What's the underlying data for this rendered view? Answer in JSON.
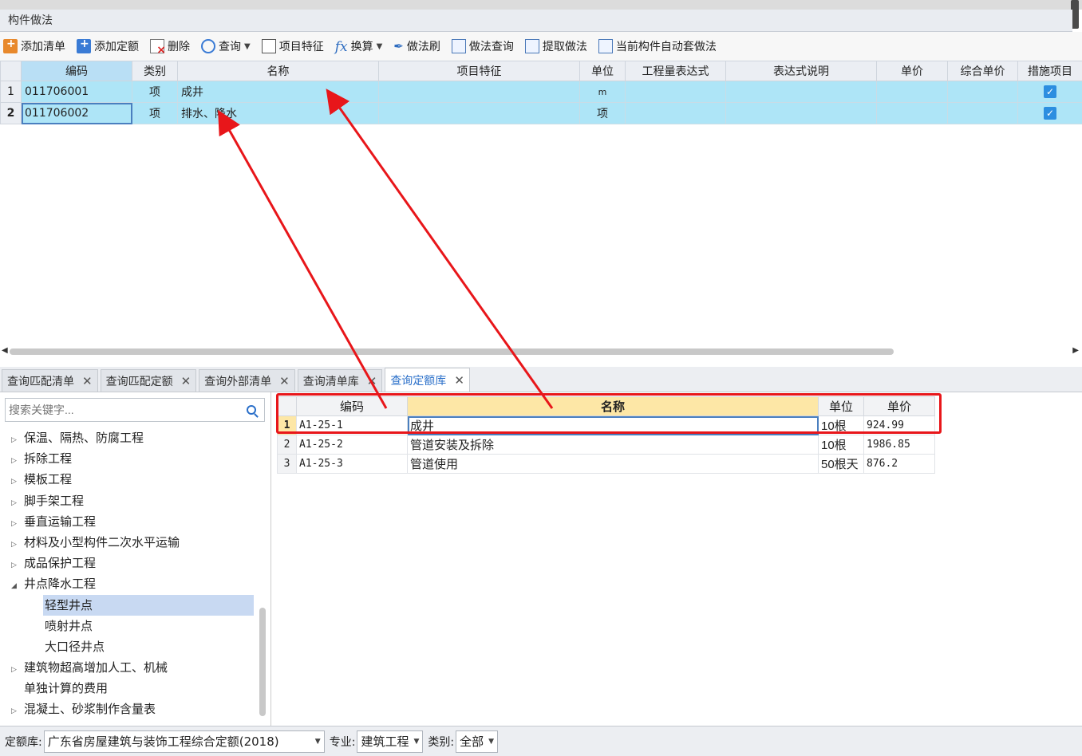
{
  "panel_title": "构件做法",
  "toolbar": {
    "add_list": "添加清单",
    "add_quota": "添加定额",
    "delete": "删除",
    "query": "查询",
    "feature": "项目特征",
    "fx_icon": "fx",
    "convert": "换算",
    "method_brush": "做法刷",
    "method_query": "做法查询",
    "extract": "提取做法",
    "auto_apply": "当前构件自动套做法"
  },
  "grid1": {
    "columns": [
      "编码",
      "类别",
      "名称",
      "项目特征",
      "单位",
      "工程量表达式",
      "表达式说明",
      "单价",
      "综合单价",
      "措施项目"
    ],
    "rows": [
      {
        "num": "1",
        "code": "011706001",
        "type": "项",
        "name": "成井",
        "feature": "",
        "unit": "m",
        "checked": true
      },
      {
        "num": "2",
        "code": "011706002",
        "type": "项",
        "name": "排水、降水",
        "feature": "",
        "unit": "项",
        "checked": true
      }
    ]
  },
  "tabs": [
    {
      "label": "查询匹配清单",
      "active": false
    },
    {
      "label": "查询匹配定额",
      "active": false
    },
    {
      "label": "查询外部清单",
      "active": false
    },
    {
      "label": "查询清单库",
      "active": false
    },
    {
      "label": "查询定额库",
      "active": true
    }
  ],
  "search": {
    "placeholder": "搜索关键字..."
  },
  "tree": [
    {
      "label": "保温、隔热、防腐工程",
      "type": "collapsed"
    },
    {
      "label": "拆除工程",
      "type": "collapsed"
    },
    {
      "label": "模板工程",
      "type": "collapsed"
    },
    {
      "label": "脚手架工程",
      "type": "collapsed"
    },
    {
      "label": "垂直运输工程",
      "type": "collapsed"
    },
    {
      "label": "材料及小型构件二次水平运输",
      "type": "collapsed"
    },
    {
      "label": "成品保护工程",
      "type": "collapsed"
    },
    {
      "label": "井点降水工程",
      "type": "expanded"
    },
    {
      "label": "轻型井点",
      "type": "child",
      "selected": true
    },
    {
      "label": "喷射井点",
      "type": "child"
    },
    {
      "label": "大口径井点",
      "type": "child"
    },
    {
      "label": "建筑物超高增加人工、机械",
      "type": "collapsed"
    },
    {
      "label": "单独计算的费用",
      "type": "leaf"
    },
    {
      "label": "混凝土、砂浆制作含量表",
      "type": "collapsed"
    }
  ],
  "grid2": {
    "columns": [
      "编码",
      "名称",
      "单位",
      "单价"
    ],
    "rows": [
      {
        "num": "1",
        "code": "A1-25-1",
        "name": "成井",
        "unit": "10根",
        "price": "924.99"
      },
      {
        "num": "2",
        "code": "A1-25-2",
        "name": "管道安装及拆除",
        "unit": "10根",
        "price": "1986.85"
      },
      {
        "num": "3",
        "code": "A1-25-3",
        "name": "管道使用",
        "unit": "50根天",
        "price": "876.2"
      }
    ]
  },
  "statusbar": {
    "quota_lib_label": "定额库:",
    "quota_lib_value": "广东省房屋建筑与装饰工程综合定额(2018)",
    "major_label": "专业:",
    "major_value": "建筑工程",
    "category_label": "类别:",
    "category_value": "全部"
  },
  "colors": {
    "selected_row": "#aee5f7",
    "annotation_red": "#e8161a",
    "active_tab_text": "#2a6fc9"
  }
}
